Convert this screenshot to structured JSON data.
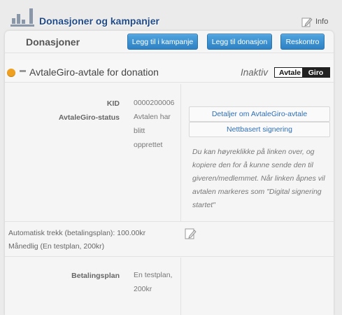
{
  "app": {
    "title": "Donasjoner og kampanjer",
    "info_label": "Info"
  },
  "panel": {
    "title": "Donasjoner",
    "buttons": {
      "add_to_campaign": "Legg til i kampanje",
      "add_donation": "Legg til donasjon",
      "reskontro": "Reskontro"
    }
  },
  "agreement": {
    "title": "AvtaleGiro-avtale for donation",
    "status": "Inaktiv",
    "logo": {
      "left": "Avtale",
      "right": "Giro"
    },
    "status_color": "#f0a020"
  },
  "details": {
    "kid_label": "KID",
    "kid_value": "0000200006",
    "status_label": "AvtaleGiro-status",
    "status_lines": [
      "Avtalen har",
      "blitt",
      "opprettet"
    ]
  },
  "actions": {
    "details_link": "Detaljer om AvtaleGiro-avtale",
    "online_signing": "Nettbasert signering",
    "note": "Du kan høyreklikke på linken over, og kopiere den for å kunne sende den til giveren/medlemmet. Når linken åpnes vil avtalen markeres som \"Digital signering startet\""
  },
  "auto_charge": {
    "text": "Automatisk trekk (betalingsplan): 100.00kr Månedlig (En testplan, 200kr)"
  },
  "payment_plan": {
    "label": "Betalingsplan",
    "value_lines": [
      "En testplan,",
      "200kr"
    ]
  },
  "icons": {
    "logo": "bar-chart-logo-icon",
    "info": "edit-note-icon",
    "edit": "edit-icon",
    "collapse": "minus-icon"
  },
  "colors": {
    "accent": "#2e82c4",
    "title": "#1f4a8a"
  }
}
